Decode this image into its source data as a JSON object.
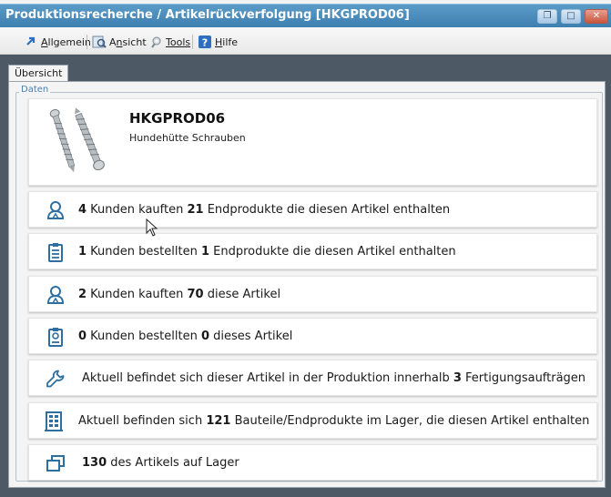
{
  "window": {
    "title": "Produktionsrecherche / Artikelrückverfolgung [HKGPROD06]"
  },
  "menu": {
    "items": [
      {
        "label_u": "A",
        "label_rest": "llgemein",
        "icon": "arrow-icon"
      },
      {
        "label_pre": "A",
        "label_u": "n",
        "label_rest": "sicht",
        "icon": "view-icon"
      },
      {
        "label_u": "T",
        "label_rest": "ools",
        "icon": "tools-icon"
      },
      {
        "label_u": "H",
        "label_rest": "ilfe",
        "icon": "help-icon"
      }
    ]
  },
  "tabs": [
    {
      "label": "Übersicht"
    }
  ],
  "group": {
    "legend": "Daten"
  },
  "product": {
    "id": "HKGPROD06",
    "name": "Hundehütte Schrauben"
  },
  "rows": [
    {
      "icon": "customer-icon",
      "n1": "4",
      "t1": " Kunden kauften ",
      "n2": "21",
      "t2": " Endprodukte die diesen Artikel enthalten"
    },
    {
      "icon": "clipboard-icon",
      "n1": "1",
      "t1": " Kunden bestellten ",
      "n2": "1",
      "t2": " Endprodukte die diesen Artikel enthalten"
    },
    {
      "icon": "customer-icon",
      "n1": "2",
      "t1": " Kunden kauften ",
      "n2": "70",
      "t2": " diese Artikel"
    },
    {
      "icon": "order-icon",
      "n1": "0",
      "t1": " Kunden bestellten ",
      "n2": "0",
      "t2": " dieses Artikel"
    },
    {
      "icon": "wrench-icon",
      "t0": "Aktuell befindet sich dieser Artikel in der Produktion innerhalb ",
      "n2": "3",
      "t2": " Fertigungsaufträgen"
    },
    {
      "icon": "warehouse-icon",
      "t0": "Aktuell befinden sich ",
      "n2": "121",
      "t2": " Bauteile/Endprodukte im Lager, die diesen Artikel enthalten"
    },
    {
      "icon": "stock-icon",
      "n1": "130",
      "t1": " des Artikels auf Lager"
    }
  ],
  "colors": {
    "titlebar": "#4a8cbd",
    "icon_blue": "#2f6f9f",
    "frame": "#4d5a66"
  }
}
